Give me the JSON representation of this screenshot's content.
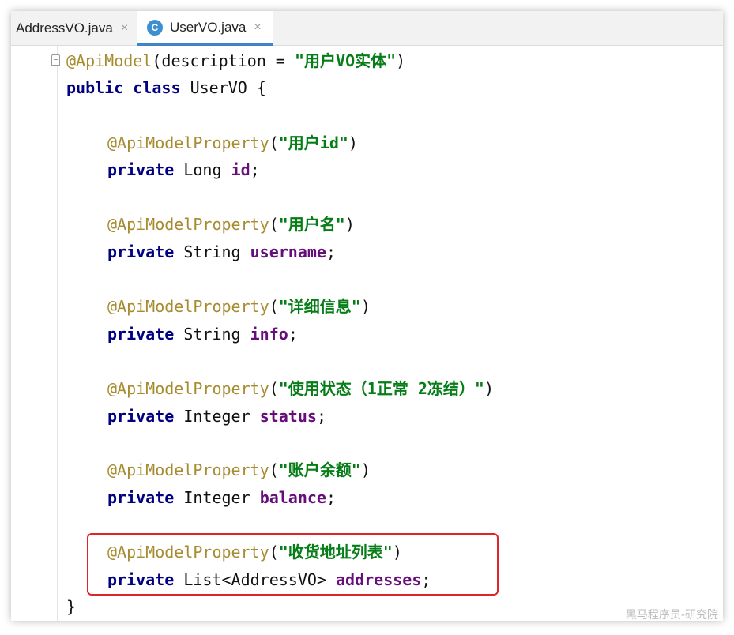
{
  "tabs": [
    {
      "label": "AddressVO.java",
      "active": false,
      "close": "×"
    },
    {
      "label": "UserVO.java",
      "active": true,
      "icon": "C",
      "close": "×"
    }
  ],
  "code": {
    "class_annotation": {
      "name": "@ApiModel",
      "open": "(",
      "param": "description",
      "eq": " = ",
      "value": "\"用户VO实体\"",
      "close": ")"
    },
    "class_decl": {
      "kw1": "public",
      "kw2": "class",
      "name": "UserVO",
      "brace": "{"
    },
    "fields": [
      {
        "annotation": "@ApiModelProperty",
        "desc": "\"用户id\"",
        "modifier": "private",
        "type": "Long",
        "name": "id"
      },
      {
        "annotation": "@ApiModelProperty",
        "desc": "\"用户名\"",
        "modifier": "private",
        "type": "String",
        "name": "username"
      },
      {
        "annotation": "@ApiModelProperty",
        "desc": "\"详细信息\"",
        "modifier": "private",
        "type": "String",
        "name": "info"
      },
      {
        "annotation": "@ApiModelProperty",
        "desc": "\"使用状态（1正常 2冻结）\"",
        "modifier": "private",
        "type": "Integer",
        "name": "status"
      },
      {
        "annotation": "@ApiModelProperty",
        "desc": "\"账户余额\"",
        "modifier": "private",
        "type": "Integer",
        "name": "balance"
      },
      {
        "annotation": "@ApiModelProperty",
        "desc": "\"收货地址列表\"",
        "modifier": "private",
        "type": "List<AddressVO>",
        "name": "addresses"
      }
    ],
    "closing_brace": "}"
  },
  "watermark": "黑马程序员-研究院",
  "colors": {
    "annotation": "#a68b2f",
    "keyword": "#000080",
    "string": "#067d17",
    "field": "#660e7a",
    "highlight": "#e0242b",
    "tab_underline": "#4083c9"
  }
}
